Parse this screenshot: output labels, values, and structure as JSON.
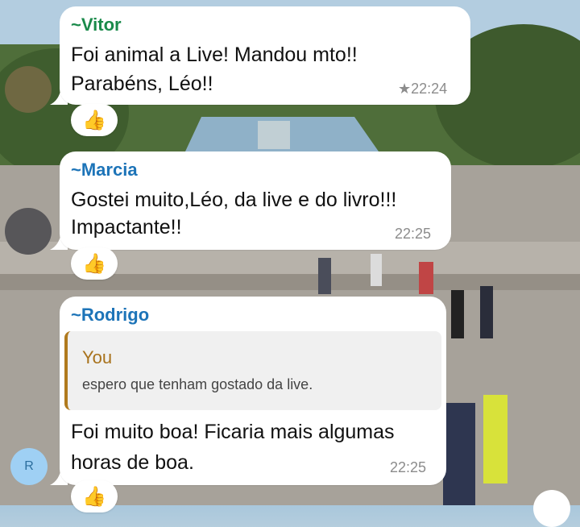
{
  "messages": [
    {
      "sender": "~Vitor",
      "lines": [
        "Foi animal a Live! Mandou mto!!",
        "Parabéns, Léo!!"
      ],
      "time": "22:24",
      "starred": true,
      "reaction": "👍"
    },
    {
      "sender": "~Marcia",
      "lines": [
        "Gostei muito,Léo, da live e do livro!!!",
        "Impactante!!"
      ],
      "time": "22:25",
      "reaction": "👍"
    },
    {
      "sender": "~Rodrigo",
      "avatar_initial": "R",
      "quote": {
        "author": "You",
        "text": "espero que tenham gostado da live."
      },
      "lines": [
        "Foi muito boa! Ficaria mais algumas",
        "horas de boa."
      ],
      "time": "22:25",
      "reaction": "👍"
    }
  ],
  "colors": {
    "sender_vitor": "#1a8a4a",
    "sender_other": "#1d74b8",
    "quote_accent": "#b07a1e",
    "bubble": "#ffffff"
  }
}
